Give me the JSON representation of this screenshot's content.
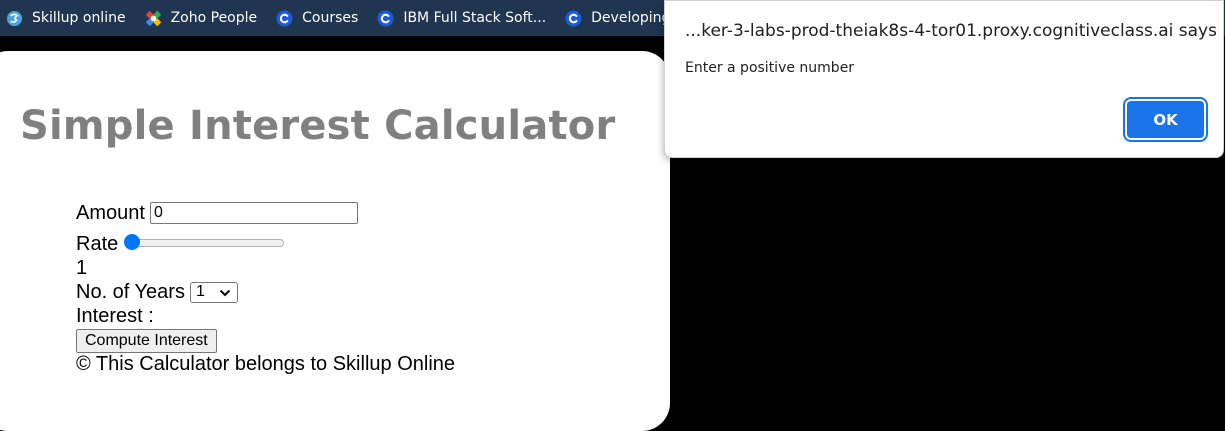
{
  "bookmarks": [
    {
      "label": "Skillup online",
      "icon": "skillup-logo-icon"
    },
    {
      "label": "Zoho People",
      "icon": "zoho-logo-icon"
    },
    {
      "label": "Courses",
      "icon": "cognitiveclass-c-icon"
    },
    {
      "label": "IBM Full Stack Soft...",
      "icon": "cognitiveclass-c-icon"
    },
    {
      "label": "Developing",
      "icon": "cognitiveclass-c-icon"
    }
  ],
  "app": {
    "title": "Simple Interest Calculator",
    "amount_label": "Amount",
    "amount_value": "0",
    "rate_label": "Rate",
    "rate_slider_fraction": 0,
    "rate_value": "1",
    "years_label": "No. of Years",
    "years_selected": "1",
    "interest_label": "Interest :",
    "compute_button": "Compute Interest",
    "footer": "© This Calculator belongs to Skillup Online"
  },
  "dialog": {
    "title": "...ker-3-labs-prod-theiak8s-4-tor01.proxy.cognitiveclass.ai says",
    "message": "Enter a positive number",
    "ok_label": "OK"
  },
  "colors": {
    "bookmark_bar": "#1f3550",
    "title_gray": "#808080",
    "accent_blue": "#1a73e8",
    "slider_blue": "#0075ff"
  }
}
